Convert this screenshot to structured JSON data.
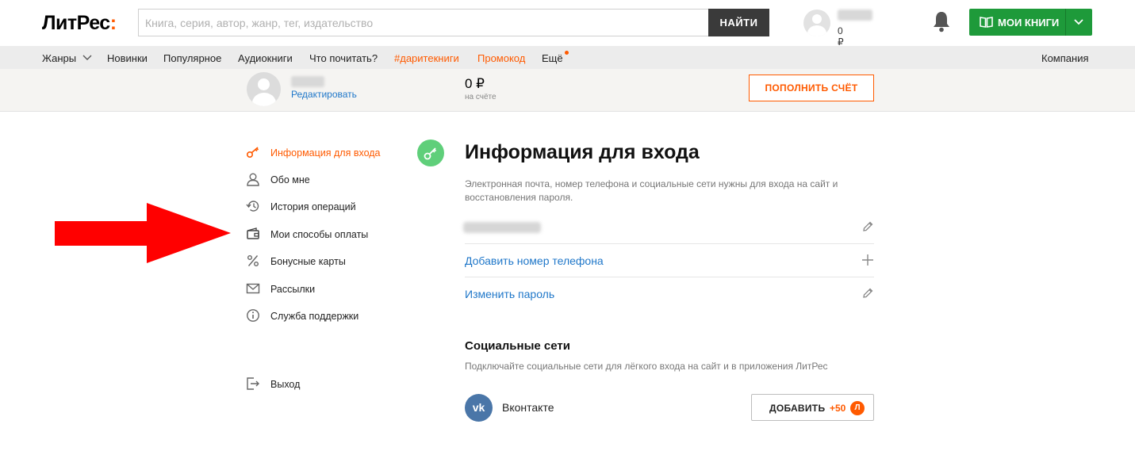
{
  "header": {
    "logo_main": "ЛитРес",
    "logo_accent": ":",
    "search_placeholder": "Книга, серия, автор, жанр, тег, издательство",
    "search_button": "НАЙТИ",
    "mini_balance": "0 ₽",
    "my_books": "МОИ КНИГИ"
  },
  "nav": {
    "items": [
      "Жанры",
      "Новинки",
      "Популярное",
      "Аудиокниги",
      "Что почитать?",
      "#даритекниги",
      "Промокод",
      "Ещё"
    ],
    "company": "Компания"
  },
  "profile": {
    "edit": "Редактировать",
    "balance": "0 ₽",
    "balance_caption": "на счёте",
    "topup": "ПОПОЛНИТЬ СЧЁТ"
  },
  "sidebar": {
    "items": [
      {
        "label": "Информация для входа",
        "icon": "key-icon"
      },
      {
        "label": "Обо мне",
        "icon": "user-icon"
      },
      {
        "label": "История операций",
        "icon": "history-icon"
      },
      {
        "label": "Мои способы оплаты",
        "icon": "wallet-icon"
      },
      {
        "label": "Бонусные карты",
        "icon": "percent-icon"
      },
      {
        "label": "Рассылки",
        "icon": "mail-icon"
      },
      {
        "label": "Служба поддержки",
        "icon": "info-icon"
      }
    ],
    "logout": "Выход"
  },
  "main": {
    "title": "Информация для входа",
    "description": "Электронная почта, номер телефона и социальные сети нужны для входа на сайт и восстановления пароля.",
    "add_phone": "Добавить номер телефона",
    "change_password": "Изменить пароль",
    "social_title": "Социальные сети",
    "social_description": "Подключайте социальные сети для лёгкого входа на сайт и в приложения ЛитРес",
    "vk_label": "Вконтакте",
    "vk_icon_text": "vk",
    "add_button": "ДОБАВИТЬ",
    "bonus": "+50",
    "bonus_coin": "Л"
  },
  "colors": {
    "accent": "#ff5a00",
    "link": "#1f77c9",
    "green": "#1e9a3a",
    "vk": "#4a76a8",
    "arrow": "#ff0000"
  }
}
